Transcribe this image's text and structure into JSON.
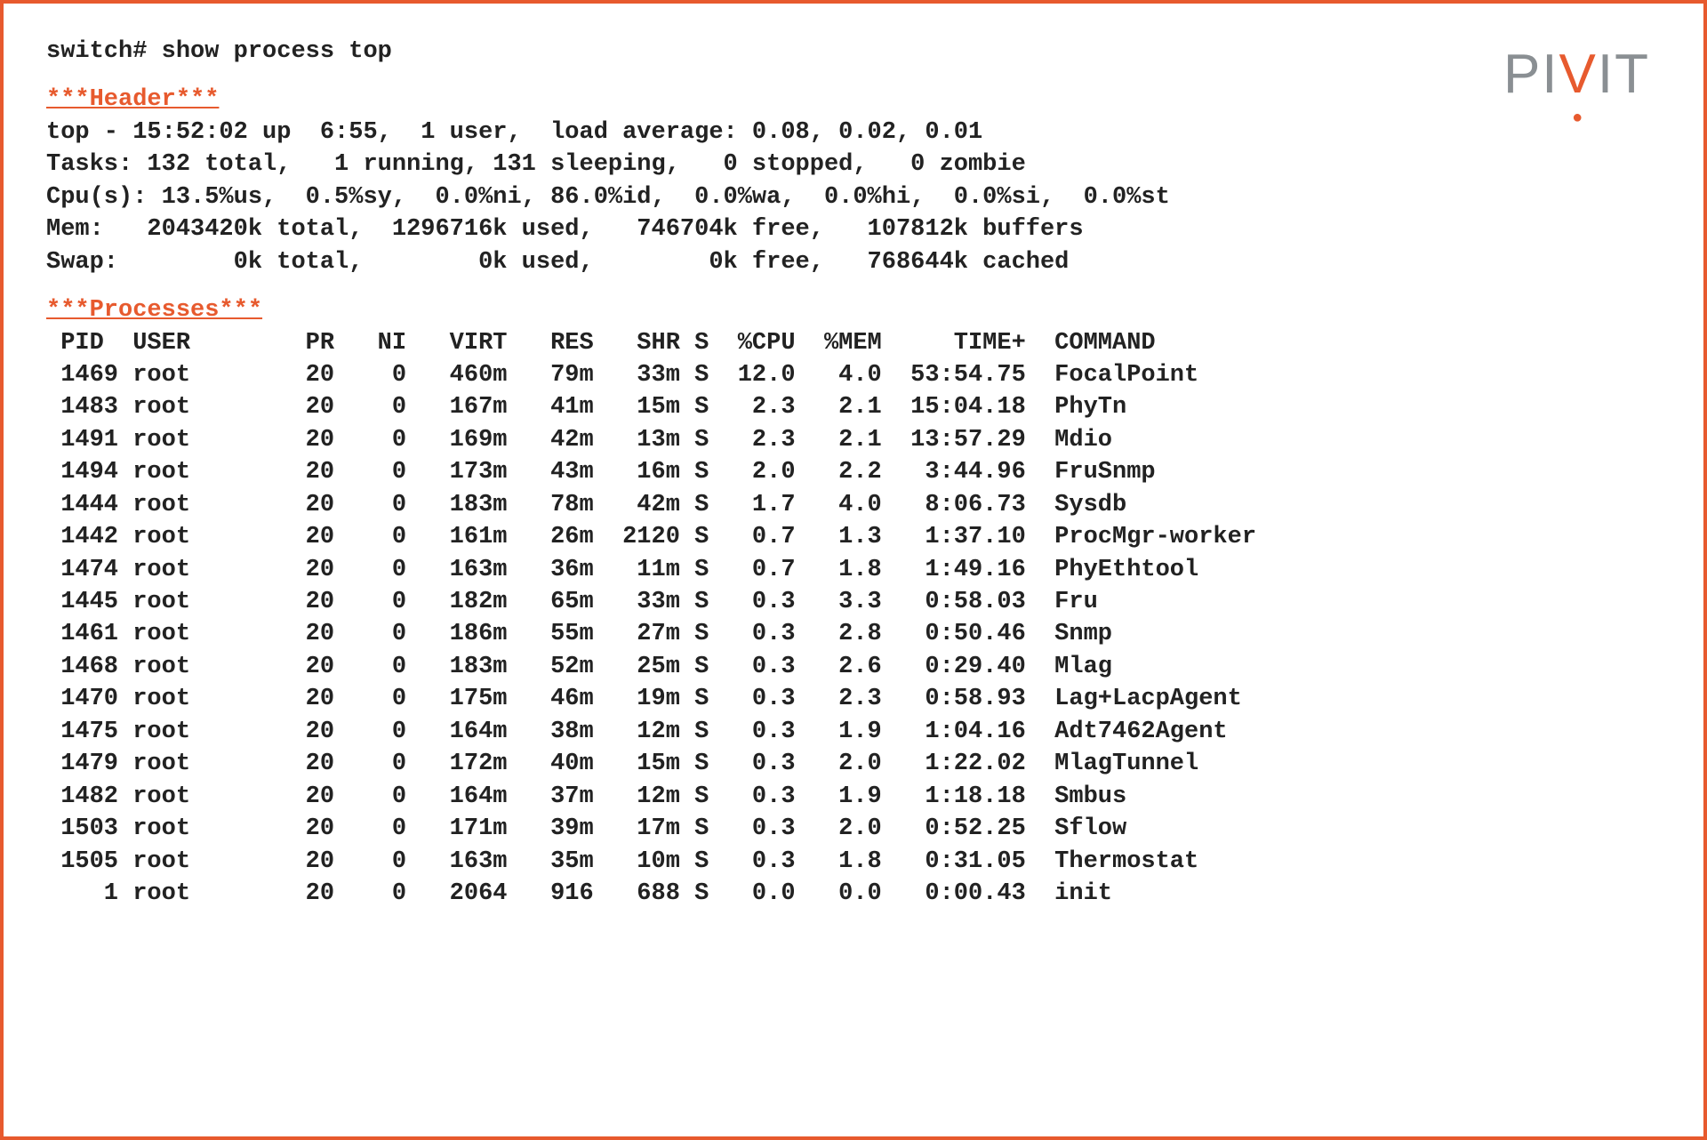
{
  "logo": {
    "p1": "PI",
    "v": "V",
    "p2": "IT"
  },
  "command": "switch# show process top",
  "section_header_title": "***Header***",
  "header": {
    "line1": "top - 15:52:02 up  6:55,  1 user,  load average: 0.08, 0.02, 0.01",
    "line2": "Tasks: 132 total,   1 running, 131 sleeping,   0 stopped,   0 zombie",
    "line3": "Cpu(s): 13.5%us,  0.5%sy,  0.0%ni, 86.0%id,  0.0%wa,  0.0%hi,  0.0%si,  0.0%st",
    "line4": "Mem:   2043420k total,  1296716k used,   746704k free,   107812k buffers",
    "line5": "Swap:        0k total,        0k used,        0k free,   768644k cached"
  },
  "section_processes_title": "***Processes***",
  "columns": [
    "PID",
    "USER",
    "PR",
    "NI",
    "VIRT",
    "RES",
    "SHR",
    "S",
    "%CPU",
    "%MEM",
    "TIME+",
    "COMMAND"
  ],
  "processes": [
    {
      "pid": 1469,
      "user": "root",
      "pr": 20,
      "ni": 0,
      "virt": "460m",
      "res": "79m",
      "shr": "33m",
      "s": "S",
      "cpu": "12.0",
      "mem": "4.0",
      "time": "53:54.75",
      "cmd": "FocalPoint"
    },
    {
      "pid": 1483,
      "user": "root",
      "pr": 20,
      "ni": 0,
      "virt": "167m",
      "res": "41m",
      "shr": "15m",
      "s": "S",
      "cpu": "2.3",
      "mem": "2.1",
      "time": "15:04.18",
      "cmd": "PhyTn"
    },
    {
      "pid": 1491,
      "user": "root",
      "pr": 20,
      "ni": 0,
      "virt": "169m",
      "res": "42m",
      "shr": "13m",
      "s": "S",
      "cpu": "2.3",
      "mem": "2.1",
      "time": "13:57.29",
      "cmd": "Mdio"
    },
    {
      "pid": 1494,
      "user": "root",
      "pr": 20,
      "ni": 0,
      "virt": "173m",
      "res": "43m",
      "shr": "16m",
      "s": "S",
      "cpu": "2.0",
      "mem": "2.2",
      "time": "3:44.96",
      "cmd": "FruSnmp"
    },
    {
      "pid": 1444,
      "user": "root",
      "pr": 20,
      "ni": 0,
      "virt": "183m",
      "res": "78m",
      "shr": "42m",
      "s": "S",
      "cpu": "1.7",
      "mem": "4.0",
      "time": "8:06.73",
      "cmd": "Sysdb"
    },
    {
      "pid": 1442,
      "user": "root",
      "pr": 20,
      "ni": 0,
      "virt": "161m",
      "res": "26m",
      "shr": "2120",
      "s": "S",
      "cpu": "0.7",
      "mem": "1.3",
      "time": "1:37.10",
      "cmd": "ProcMgr-worker"
    },
    {
      "pid": 1474,
      "user": "root",
      "pr": 20,
      "ni": 0,
      "virt": "163m",
      "res": "36m",
      "shr": "11m",
      "s": "S",
      "cpu": "0.7",
      "mem": "1.8",
      "time": "1:49.16",
      "cmd": "PhyEthtool"
    },
    {
      "pid": 1445,
      "user": "root",
      "pr": 20,
      "ni": 0,
      "virt": "182m",
      "res": "65m",
      "shr": "33m",
      "s": "S",
      "cpu": "0.3",
      "mem": "3.3",
      "time": "0:58.03",
      "cmd": "Fru"
    },
    {
      "pid": 1461,
      "user": "root",
      "pr": 20,
      "ni": 0,
      "virt": "186m",
      "res": "55m",
      "shr": "27m",
      "s": "S",
      "cpu": "0.3",
      "mem": "2.8",
      "time": "0:50.46",
      "cmd": "Snmp"
    },
    {
      "pid": 1468,
      "user": "root",
      "pr": 20,
      "ni": 0,
      "virt": "183m",
      "res": "52m",
      "shr": "25m",
      "s": "S",
      "cpu": "0.3",
      "mem": "2.6",
      "time": "0:29.40",
      "cmd": "Mlag"
    },
    {
      "pid": 1470,
      "user": "root",
      "pr": 20,
      "ni": 0,
      "virt": "175m",
      "res": "46m",
      "shr": "19m",
      "s": "S",
      "cpu": "0.3",
      "mem": "2.3",
      "time": "0:58.93",
      "cmd": "Lag+LacpAgent"
    },
    {
      "pid": 1475,
      "user": "root",
      "pr": 20,
      "ni": 0,
      "virt": "164m",
      "res": "38m",
      "shr": "12m",
      "s": "S",
      "cpu": "0.3",
      "mem": "1.9",
      "time": "1:04.16",
      "cmd": "Adt7462Agent"
    },
    {
      "pid": 1479,
      "user": "root",
      "pr": 20,
      "ni": 0,
      "virt": "172m",
      "res": "40m",
      "shr": "15m",
      "s": "S",
      "cpu": "0.3",
      "mem": "2.0",
      "time": "1:22.02",
      "cmd": "MlagTunnel"
    },
    {
      "pid": 1482,
      "user": "root",
      "pr": 20,
      "ni": 0,
      "virt": "164m",
      "res": "37m",
      "shr": "12m",
      "s": "S",
      "cpu": "0.3",
      "mem": "1.9",
      "time": "1:18.18",
      "cmd": "Smbus"
    },
    {
      "pid": 1503,
      "user": "root",
      "pr": 20,
      "ni": 0,
      "virt": "171m",
      "res": "39m",
      "shr": "17m",
      "s": "S",
      "cpu": "0.3",
      "mem": "2.0",
      "time": "0:52.25",
      "cmd": "Sflow"
    },
    {
      "pid": 1505,
      "user": "root",
      "pr": 20,
      "ni": 0,
      "virt": "163m",
      "res": "35m",
      "shr": "10m",
      "s": "S",
      "cpu": "0.3",
      "mem": "1.8",
      "time": "0:31.05",
      "cmd": "Thermostat"
    },
    {
      "pid": 1,
      "user": "root",
      "pr": 20,
      "ni": 0,
      "virt": "2064",
      "res": "916",
      "shr": "688",
      "s": "S",
      "cpu": "0.0",
      "mem": "0.0",
      "time": "0:00.43",
      "cmd": "init"
    }
  ]
}
